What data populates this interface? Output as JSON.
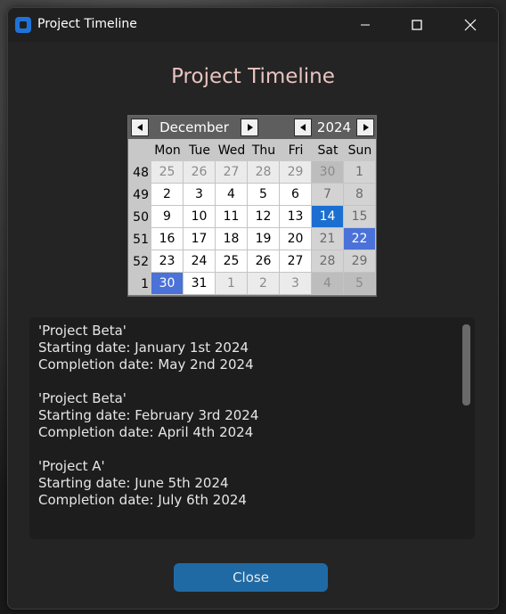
{
  "window": {
    "title": "Project Timeline"
  },
  "page_title": "Project Timeline",
  "calendar": {
    "month": "December",
    "year": "2024",
    "weekdays": [
      "Mon",
      "Tue",
      "Wed",
      "Thu",
      "Fri",
      "Sat",
      "Sun"
    ],
    "weeks": [
      {
        "wk": "48",
        "days": [
          "25",
          "26",
          "27",
          "28",
          "29",
          "30",
          "1"
        ]
      },
      {
        "wk": "49",
        "days": [
          "2",
          "3",
          "4",
          "5",
          "6",
          "7",
          "8"
        ]
      },
      {
        "wk": "50",
        "days": [
          "9",
          "10",
          "11",
          "12",
          "13",
          "14",
          "15"
        ]
      },
      {
        "wk": "51",
        "days": [
          "16",
          "17",
          "18",
          "19",
          "20",
          "21",
          "22"
        ]
      },
      {
        "wk": "52",
        "days": [
          "23",
          "24",
          "25",
          "26",
          "27",
          "28",
          "29"
        ]
      },
      {
        "wk": "1",
        "days": [
          "30",
          "31",
          "1",
          "2",
          "3",
          "4",
          "5"
        ]
      }
    ],
    "today": "14",
    "selected": [
      "22",
      "30"
    ]
  },
  "projects": [
    {
      "name": "'Project Beta'",
      "start": "Starting date: January 1st 2024",
      "end": "Completion date: May 2nd 2024"
    },
    {
      "name": "'Project Beta'",
      "start": "Starting date: February 3rd 2024",
      "end": "Completion date: April 4th 2024"
    },
    {
      "name": "'Project A'",
      "start": "Starting date: June 5th 2024",
      "end": "Completion date: July 6th 2024"
    }
  ],
  "close_label": "Close",
  "colors": {
    "accent": "#1f6aa5",
    "today": "#1a6fd0",
    "selected": "#4a72d8",
    "title_text": "#e8c3c0"
  }
}
